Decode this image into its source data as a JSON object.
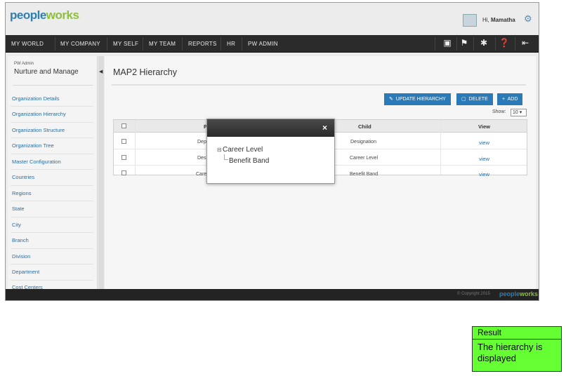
{
  "header": {
    "logo": {
      "part1": "people",
      "part2": "works"
    },
    "greeting": "Hi,",
    "user_name": "Mamatha",
    "icons": {
      "avatar": "avatar",
      "settings": "gear-icon"
    }
  },
  "nav": {
    "items": [
      "MY WORLD",
      "MY COMPANY",
      "MY SELF",
      "MY TEAM",
      "REPORTS",
      "HR",
      "PW ADMIN"
    ],
    "right_icons": {
      "book": "📖",
      "flag": "✈",
      "tools": "✱",
      "help": "❓",
      "logout": "⇥"
    }
  },
  "sidebar": {
    "subtitle": "PW Admin",
    "title": "Nurture and Manage",
    "items": [
      "Organization Details",
      "Organization Hierarchy",
      "Organization Structure",
      "Organization Tree",
      "Master Configuration",
      "Countries",
      "Regions",
      "State",
      "City",
      "Branch",
      "Division",
      "Department",
      "Cost Centers"
    ]
  },
  "main": {
    "page_title": "MAP2 Hierarchy",
    "buttons": {
      "update": "UPDATE HIERARCHY",
      "delete": "DELETE",
      "add": "ADD"
    },
    "show_label": "Show:",
    "show_value": "10 ▾",
    "table": {
      "columns": [
        "P",
        "Child",
        "View"
      ],
      "rows": [
        {
          "parent": "Dep",
          "child": "Designation",
          "view": "view"
        },
        {
          "parent": "Des",
          "child": "Career Level",
          "view": "view"
        },
        {
          "parent": "Care",
          "child": "Benefit Band",
          "view": "view"
        }
      ]
    }
  },
  "modal": {
    "close": "×",
    "tree_toggle": "⊟",
    "root": "Career Level",
    "child": "Benefit Band"
  },
  "footer": {
    "copyright": "© Copyright 2015",
    "logo": {
      "part1": "people",
      "part2": "works"
    }
  },
  "result": {
    "heading": "Result",
    "text": "The hierarchy is displayed"
  }
}
